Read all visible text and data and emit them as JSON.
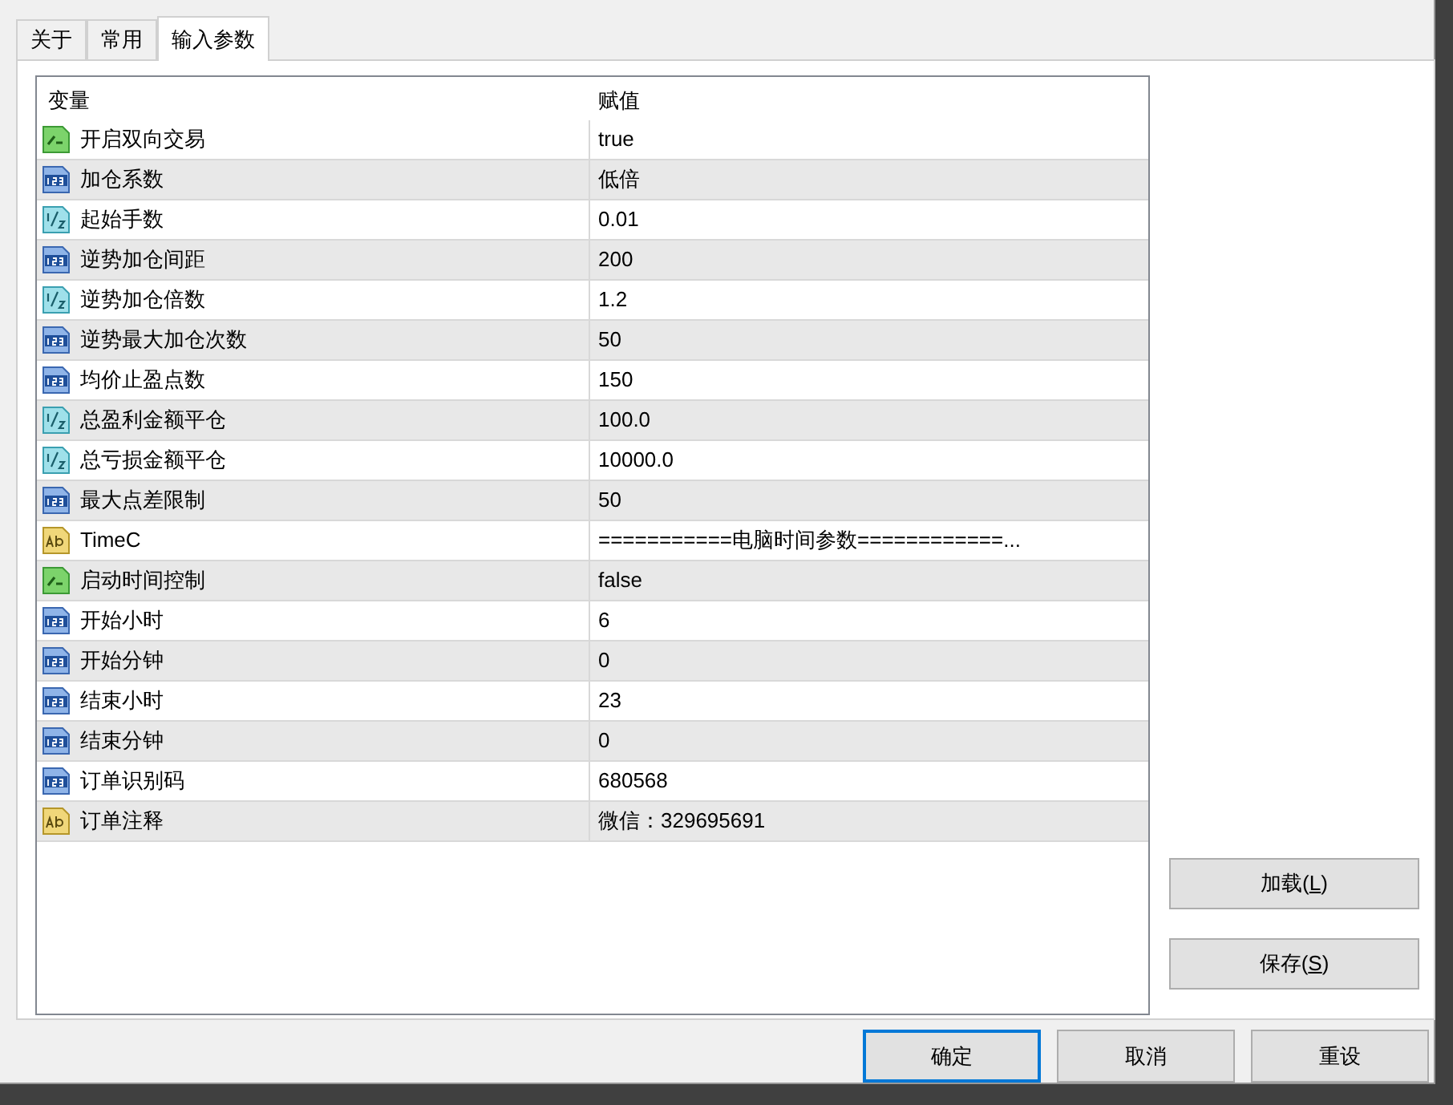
{
  "tabs": [
    {
      "label": "关于",
      "selected": false
    },
    {
      "label": "常用",
      "selected": false
    },
    {
      "label": "输入参数",
      "selected": true
    }
  ],
  "table": {
    "columns": [
      "变量",
      "赋值"
    ],
    "rows": [
      {
        "kind": "bool",
        "name": "开启双向交易",
        "value": "true"
      },
      {
        "kind": "int",
        "name": "加仓系数",
        "value": "低倍"
      },
      {
        "kind": "double",
        "name": "起始手数",
        "value": "0.01"
      },
      {
        "kind": "int",
        "name": "逆势加仓间距",
        "value": "200"
      },
      {
        "kind": "double",
        "name": "逆势加仓倍数",
        "value": "1.2"
      },
      {
        "kind": "int",
        "name": "逆势最大加仓次数",
        "value": "50"
      },
      {
        "kind": "int",
        "name": "均价止盈点数",
        "value": "150"
      },
      {
        "kind": "double",
        "name": "总盈利金额平仓",
        "value": "100.0"
      },
      {
        "kind": "double",
        "name": "总亏损金额平仓",
        "value": "10000.0"
      },
      {
        "kind": "int",
        "name": "最大点差限制",
        "value": "50"
      },
      {
        "kind": "string",
        "name": "TimeC",
        "value": "===========电脑时间参数============..."
      },
      {
        "kind": "bool",
        "name": "启动时间控制",
        "value": "false"
      },
      {
        "kind": "int",
        "name": "开始小时",
        "value": "6"
      },
      {
        "kind": "int",
        "name": "开始分钟",
        "value": "0"
      },
      {
        "kind": "int",
        "name": "结束小时",
        "value": "23"
      },
      {
        "kind": "int",
        "name": "结束分钟",
        "value": "0"
      },
      {
        "kind": "int",
        "name": "订单识别码",
        "value": "680568"
      },
      {
        "kind": "string",
        "name": "订单注释",
        "value": "微信：329695691"
      }
    ]
  },
  "side_buttons": [
    {
      "label": "加载(",
      "shortcut": "L",
      "label_end": ")"
    },
    {
      "label": "保存(",
      "shortcut": "S",
      "label_end": ")"
    }
  ],
  "dialog_buttons": [
    {
      "label": "确定",
      "default": true
    },
    {
      "label": "取消",
      "default": false
    },
    {
      "label": "重设",
      "default": false
    }
  ]
}
